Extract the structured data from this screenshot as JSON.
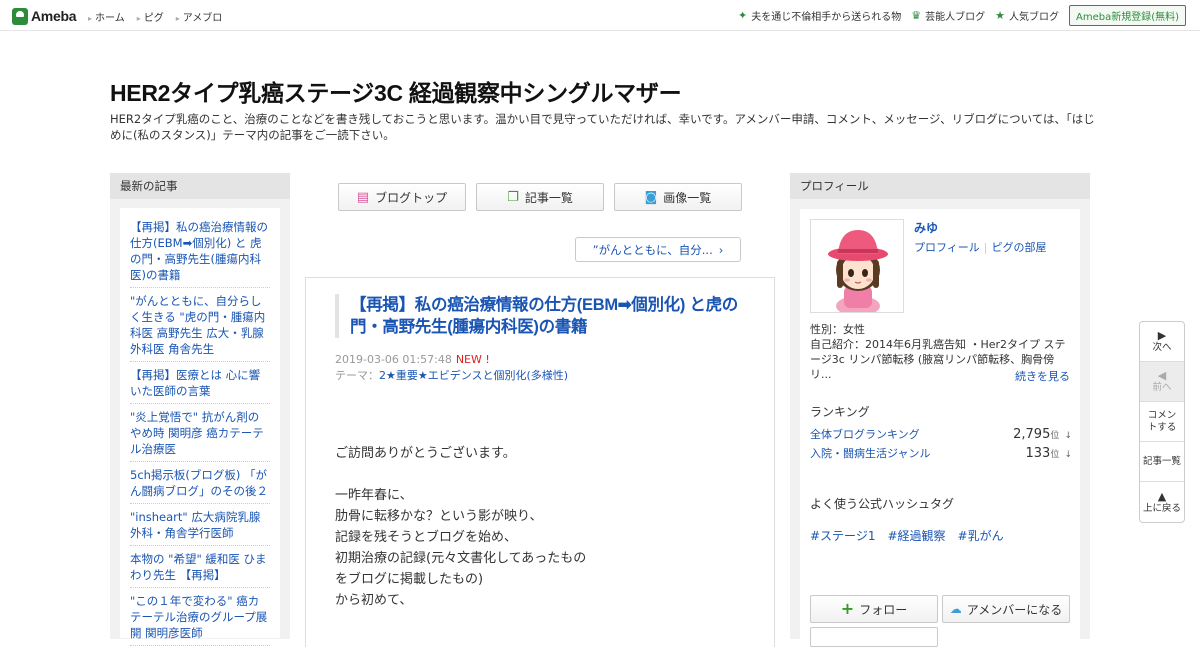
{
  "header": {
    "logo": "Ameba",
    "nav": [
      "ホーム",
      "ピグ",
      "アメブロ"
    ],
    "right": [
      {
        "icon": "sparkle-icon",
        "label": "夫を通じ不倫相手から送られる物"
      },
      {
        "icon": "crown-icon",
        "label": "芸能人ブログ"
      },
      {
        "icon": "star-icon",
        "label": "人気ブログ"
      }
    ],
    "signup": "Ameba新規登録(無料)"
  },
  "blog": {
    "title": "HER2タイプ乳癌ステージ3C 経過観察中シングルマザー",
    "description": "HER2タイプ乳癌のこと、治療のことなどを書き残しておこうと思います。温かい目で見守っていただければ、幸いです。アメンバー申請、コメント、メッセージ、リブログについては、「はじめに(私のスタンス)」テーマ内の記事をご一読下さい。"
  },
  "left": {
    "heading": "最新の記事",
    "articles": [
      "【再掲】私の癌治療情報の仕方(EBM➡個別化) と 虎の門・高野先生(腫瘍内科医)の書籍",
      "\"がんとともに、自分らしく生きる \"虎の門・腫瘍内科医 高野先生 広大・乳腺外科医 角舎先生",
      "【再掲】医療とは 心に響いた医師の言葉",
      "\"炎上覚悟で\" 抗がん剤のやめ時 関明彦 癌カテーテル治療医",
      "5ch掲示板(ブログ板) 「がん闘病ブログ」のその後２",
      "\"insheart\" 広大病院乳腺外科・角舎学行医師",
      "本物の \"希望\" 緩和医 ひまわり先生 【再掲】",
      "\"この１年で変わる\" 癌カテーテル治療のグループ展開 関明彦医師"
    ]
  },
  "center": {
    "tabs": [
      {
        "icon": "document-icon",
        "label": "ブログトップ"
      },
      {
        "icon": "copy-icon",
        "label": "記事一覧"
      },
      {
        "icon": "camera-icon",
        "label": "画像一覧"
      }
    ],
    "prev_link": "”がんとともに、自分...",
    "entry": {
      "title": "【再掲】私の癌治療情報の仕方(EBM➡個別化) と虎の門・高野先生(腫瘍内科医)の書籍",
      "date": "2019-03-06 01:57:48",
      "new": "NEW !",
      "theme_label": "テーマ：",
      "theme": "2★重要★エビデンスと個別化(多様性)",
      "body": "ご訪問ありがとうございます。\n\n一昨年春に、\n肋骨に転移かな？という影が映り、\n記録を残そうとブログを始め、\n初期治療の記録(元々文書化してあったもの\nをブログに掲載したもの)\nから初めて、"
    }
  },
  "right": {
    "heading": "プロフィール",
    "name": "みゆ",
    "links": [
      "プロフィール",
      "ピグの部屋"
    ],
    "gender": "性別：女性",
    "intro": "自己紹介：2014年6月乳癌告知 ・Her2タイプ ステージ3c リンパ節転移 (腋窩リンパ節転移、胸骨傍リ...",
    "more": "続きを見る",
    "ranking_heading": "ランキング",
    "rankings": [
      {
        "label": "全体ブログランキング",
        "value": "2,795",
        "unit": "位",
        "trend": "↓"
      },
      {
        "label": "入院・闘病生活ジャンル",
        "value": "133",
        "unit": "位",
        "trend": "↓"
      }
    ],
    "tags_heading": "よく使う公式ハッシュタグ",
    "tags": [
      "#ステージ1",
      "#経過観察",
      "#乳がん"
    ],
    "follow": "フォロー",
    "amember": "アメンバーになる"
  },
  "sidenav": [
    {
      "icon": "next-icon",
      "label": "次へ",
      "disabled": false
    },
    {
      "icon": "prev-icon",
      "label": "前へ",
      "disabled": true
    },
    {
      "icon": "comment-icon",
      "label": "コメントする",
      "disabled": false
    },
    {
      "icon": "list-icon",
      "label": "記事一覧",
      "disabled": false
    },
    {
      "icon": "up-icon",
      "label": "上に戻る",
      "disabled": false
    }
  ],
  "colors": {
    "accent": "#2d8c3c",
    "link": "#1a55b3",
    "new": "#e02020"
  }
}
